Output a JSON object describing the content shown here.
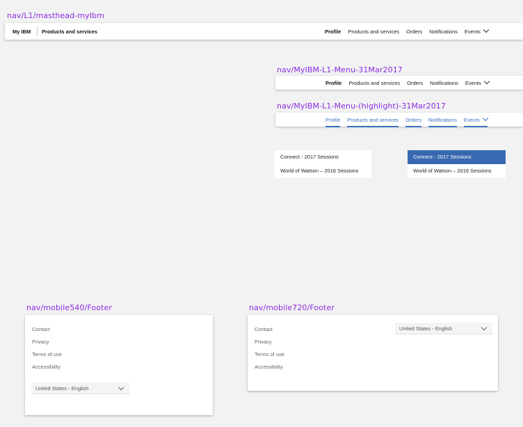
{
  "captions": {
    "masthead": "nav/L1/masthead-myIbm",
    "menu": "nav/MyIBM-L1-Menu-31Mar2017",
    "menu_highlight": "nav/MyIBM-L1-Menu-(highlight)-31Mar2017",
    "footer540": "nav/mobile540/Footer",
    "footer720": "nav/mobile720/Footer"
  },
  "masthead": {
    "brand": "My IBM",
    "product": "Products and services",
    "items": [
      "Profile",
      "Products and services",
      "Orders",
      "Notifications",
      "Events"
    ]
  },
  "menu": {
    "items": [
      "Profile",
      "Products and services",
      "Orders",
      "Notifications",
      "Events"
    ]
  },
  "menu_highlight": {
    "items": [
      "Profile",
      "Products and services",
      "Orders",
      "Notifications",
      "Events"
    ],
    "color": "#3b73c4"
  },
  "dropdown": {
    "items": [
      "Connect - 2017 Sessions",
      "World of Watson – 2016 Sessions"
    ]
  },
  "dropdown_active": {
    "items": [
      "Connect - 2017 Sessions",
      "World of Watson – 2016 Sessions"
    ],
    "active_color": "#3869b0"
  },
  "footer": {
    "links": [
      "Contact",
      "Privacy",
      "Terms of use",
      "Accessibility"
    ],
    "language": "United States - English"
  },
  "icons": {
    "dropdown": "chevron-down-icon"
  }
}
